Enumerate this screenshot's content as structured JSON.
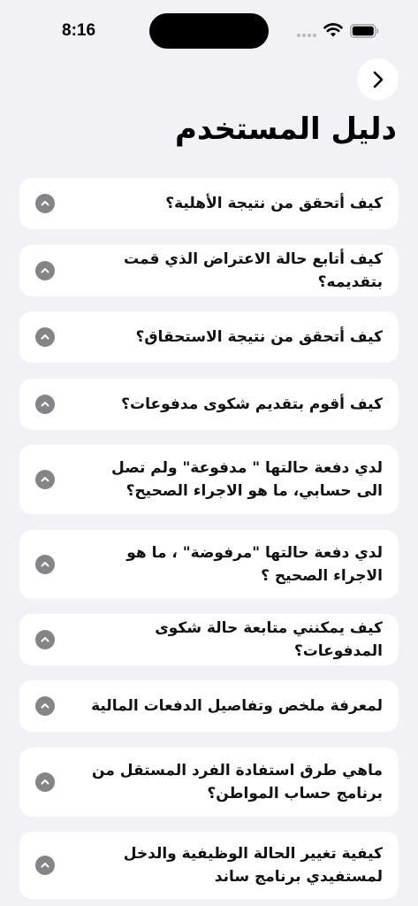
{
  "status_bar": {
    "time": "8:16"
  },
  "nav": {
    "back_icon": "chevron-right-icon"
  },
  "page": {
    "title": "دليل المستخدم"
  },
  "faq": [
    {
      "question": "كيف أتحقق من نتيجة الأهلية؟"
    },
    {
      "question": "كيف أتابع حالة الاعتراض الذي قمت بتقديمه؟"
    },
    {
      "question": "كيف أتحقق من نتيجة الاستحقاق؟"
    },
    {
      "question": "كيف أقوم بتقديم شكوى مدفوعات؟"
    },
    {
      "question": "لدي دفعة حالتها \" مدفوعة\" ولم تصل الى حسابي، ما هو الاجراء الصحيح؟"
    },
    {
      "question": "لدي دفعة حالتها \"مرفوضة\" ، ما هو الاجراء الصحيح ؟"
    },
    {
      "question": "كيف يمكنني متابعة حالة شكوى المدفوعات؟"
    },
    {
      "question": "لمعرفة ملخص وتفاصيل الدفعات المالية"
    },
    {
      "question": "ماهي طرق استفادة الفرد المستقل من برنامج حساب المواطن؟"
    },
    {
      "question": "كيفية تغيير الحالة الوظيفية والدخل لمستفيدي برنامج ساند"
    }
  ],
  "colors": {
    "background": "#f2f2f6",
    "card": "#ffffff",
    "icon": "#858589"
  }
}
